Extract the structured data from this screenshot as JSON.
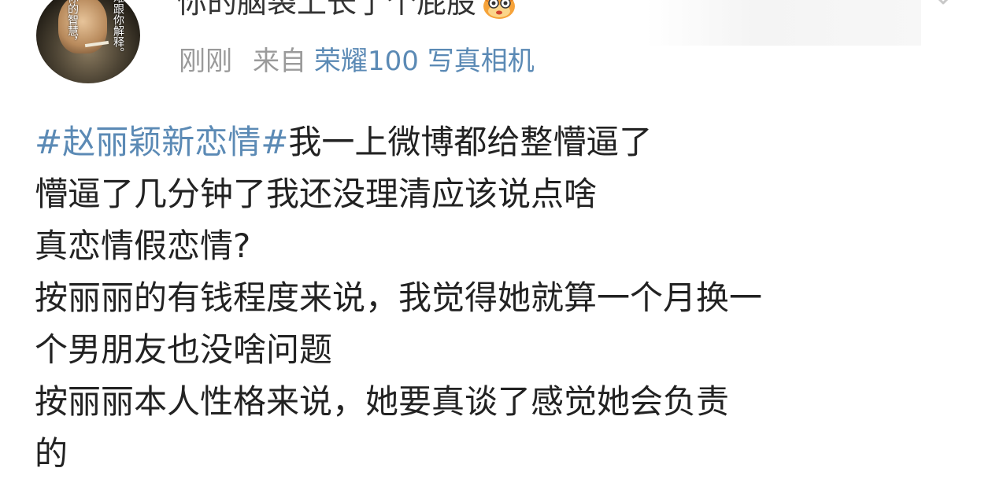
{
  "post": {
    "user": {
      "name": "你的脑袋上长了个屁股",
      "avatar_text": [
        "你的智慧，",
        "很难跟你解释。"
      ]
    },
    "time": "刚刚",
    "source_prefix": "来自",
    "source_device": "荣耀100 写真相机",
    "hashtag": "#赵丽颖新恋情#",
    "lines": [
      "我一上微博都给整懵逼了",
      "懵逼了几分钟了我还没理清应该说点啥",
      "真恋情假恋情?",
      "按丽丽的有钱程度来说，我觉得她就算一个月换一",
      "个男朋友也没啥问题",
      "按丽丽本人性格来说，她要真谈了感觉她会负责",
      "的"
    ]
  },
  "colors": {
    "link": "#5b8ab5",
    "meta": "#9a9a9a",
    "text": "#222222"
  },
  "icons": {
    "name_badge": "pufferfish-emoji-icon",
    "menu": "chevron-down-icon"
  }
}
